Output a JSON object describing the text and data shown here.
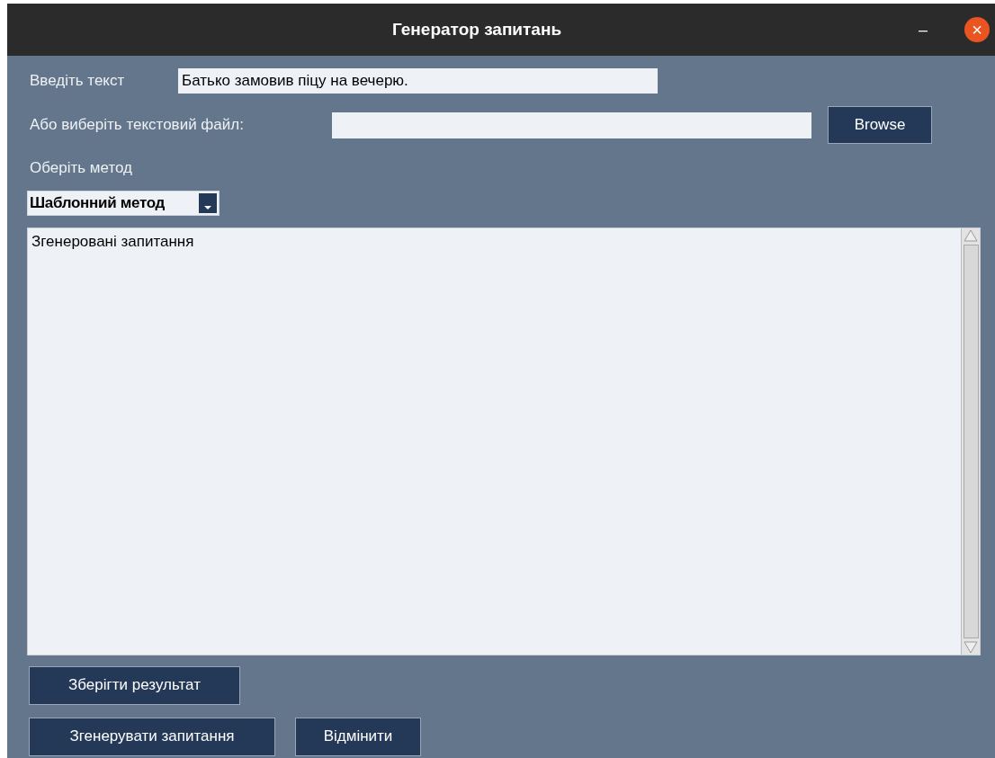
{
  "window": {
    "title": "Генератор запитань",
    "controls": [
      "–",
      "×"
    ]
  },
  "text_input": {
    "label": "Введіть текст",
    "value": "Батько замовив піцу на вечерю."
  },
  "file_input": {
    "label": "Або виберіть текстовий файл:",
    "button": "Browse"
  },
  "method": {
    "label": "Оберіть метод",
    "value": "Шаблонний метод"
  },
  "output": {
    "value": "Згенеровані запитання"
  },
  "buttons": [
    "Зберігти результат",
    "Згенерувати запитання",
    "Відмінити"
  ]
}
